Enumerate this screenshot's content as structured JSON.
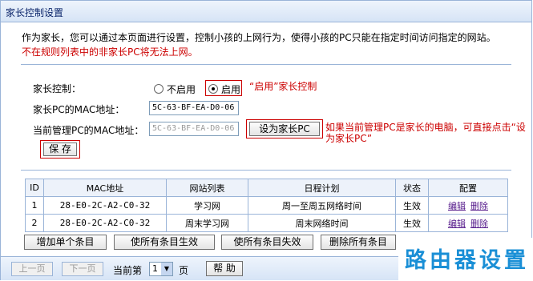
{
  "title": "家长控制设置",
  "description": "作为家长，您可以通过本页面进行设置，控制小孩的上网行为，使得小孩的PC只能在指定时间访问指定的网站。",
  "warning": "不在规则列表中的非家长PC将无法上网。",
  "form": {
    "control_label": "家长控制：",
    "disable_label": "不启用",
    "enable_label": "启用",
    "enable_note": "“启用”家长控制",
    "parent_mac_label": "家长PC的MAC地址：",
    "parent_mac_value": "5C-63-BF-EA-D0-06",
    "current_mac_label": "当前管理PC的MAC地址：",
    "current_mac_value": "5C-63-BF-EA-D0-06",
    "set_parent_button": "设为家长PC",
    "set_parent_note": "如果当前管理PC是家长的电脑，可直接点击“设为家长PC”",
    "save_button": "保 存"
  },
  "table": {
    "headers": [
      "ID",
      "MAC地址",
      "网站列表",
      "日程计划",
      "状态",
      "配置"
    ],
    "rows": [
      {
        "id": "1",
        "mac": "28-E0-2C-A2-C0-32",
        "sites": "学习网",
        "schedule": "周一至周五网络时间",
        "status": "生效",
        "edit": "编辑",
        "delete": "删除"
      },
      {
        "id": "2",
        "mac": "28-E0-2C-A2-C0-32",
        "sites": "周末学习网",
        "schedule": "周末网络时间",
        "status": "生效",
        "edit": "编辑",
        "delete": "删除"
      }
    ]
  },
  "actions": {
    "add": "增加单个条目",
    "enable_all": "使所有条目生效",
    "disable_all": "使所有条目失效",
    "delete_all": "删除所有条目"
  },
  "pager": {
    "prev": "上一页",
    "next": "下一页",
    "current_label": "当前第",
    "page_value": "1",
    "page_unit": "页",
    "help": "帮 助"
  },
  "watermark": "路由器设置"
}
